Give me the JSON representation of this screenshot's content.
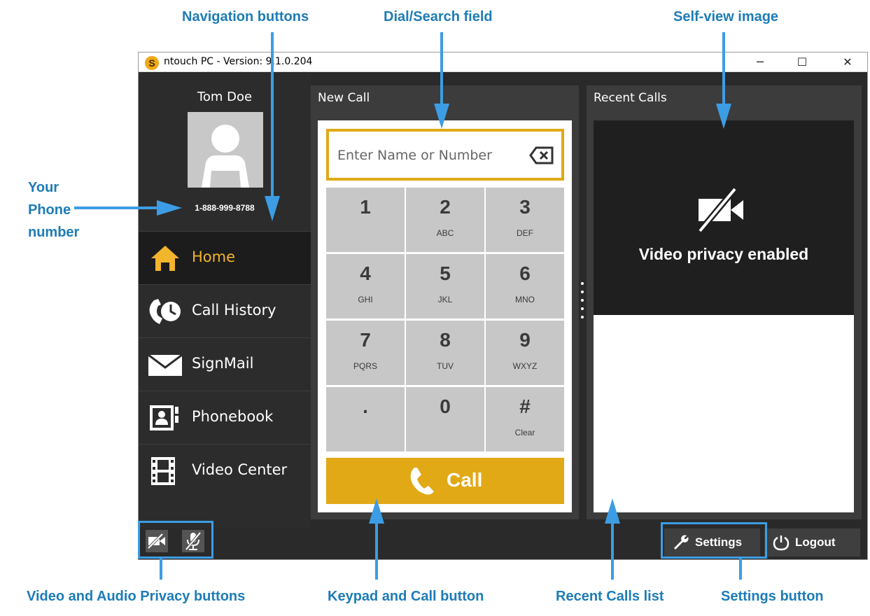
{
  "callouts": {
    "navigation": "Navigation buttons",
    "dial_search": "Dial/Search field",
    "self_view": "Self-view image",
    "phone_line1": "Your",
    "phone_line2": "Phone",
    "phone_line3": "number",
    "privacy": "Video and Audio Privacy buttons",
    "keypad": "Keypad and Call button",
    "recent_list": "Recent Calls list",
    "settings": "Settings button"
  },
  "window": {
    "title": "ntouch PC  -  Version: 9.1.0.204",
    "logo_letter": "S",
    "minimize_glyph": "─",
    "maximize_glyph": "☐",
    "close_glyph": "✕"
  },
  "sidebar": {
    "user_name": "Tom Doe",
    "phone_number": "1-888-999-8788",
    "items": [
      {
        "label": "Home",
        "icon": "home-icon",
        "active": true
      },
      {
        "label": "Call History",
        "icon": "call-history-icon",
        "active": false
      },
      {
        "label": "SignMail",
        "icon": "envelope-icon",
        "active": false
      },
      {
        "label": "Phonebook",
        "icon": "phonebook-icon",
        "active": false
      },
      {
        "label": "Video Center",
        "icon": "film-icon",
        "active": false
      }
    ]
  },
  "new_call": {
    "title": "New Call",
    "placeholder": "Enter Name or Number",
    "keys": [
      {
        "digit": "1",
        "letters": ""
      },
      {
        "digit": "2",
        "letters": "ABC"
      },
      {
        "digit": "3",
        "letters": "DEF"
      },
      {
        "digit": "4",
        "letters": "GHI"
      },
      {
        "digit": "5",
        "letters": "JKL"
      },
      {
        "digit": "6",
        "letters": "MNO"
      },
      {
        "digit": "7",
        "letters": "PQRS"
      },
      {
        "digit": "8",
        "letters": "TUV"
      },
      {
        "digit": "9",
        "letters": "WXYZ"
      },
      {
        "digit": ".",
        "letters": ""
      },
      {
        "digit": "0",
        "letters": ""
      },
      {
        "digit": "#",
        "letters": "Clear"
      }
    ],
    "call_label": "Call"
  },
  "recent_calls": {
    "title": "Recent Calls",
    "privacy_text": "Video privacy enabled"
  },
  "bottom_bar": {
    "settings_label": "Settings",
    "logout_label": "Logout"
  },
  "colors": {
    "accent": "#e1a916",
    "callout_text": "#1d7cb7",
    "callout_arrow": "#3c9de4",
    "window_bg": "#2a2a2a"
  }
}
